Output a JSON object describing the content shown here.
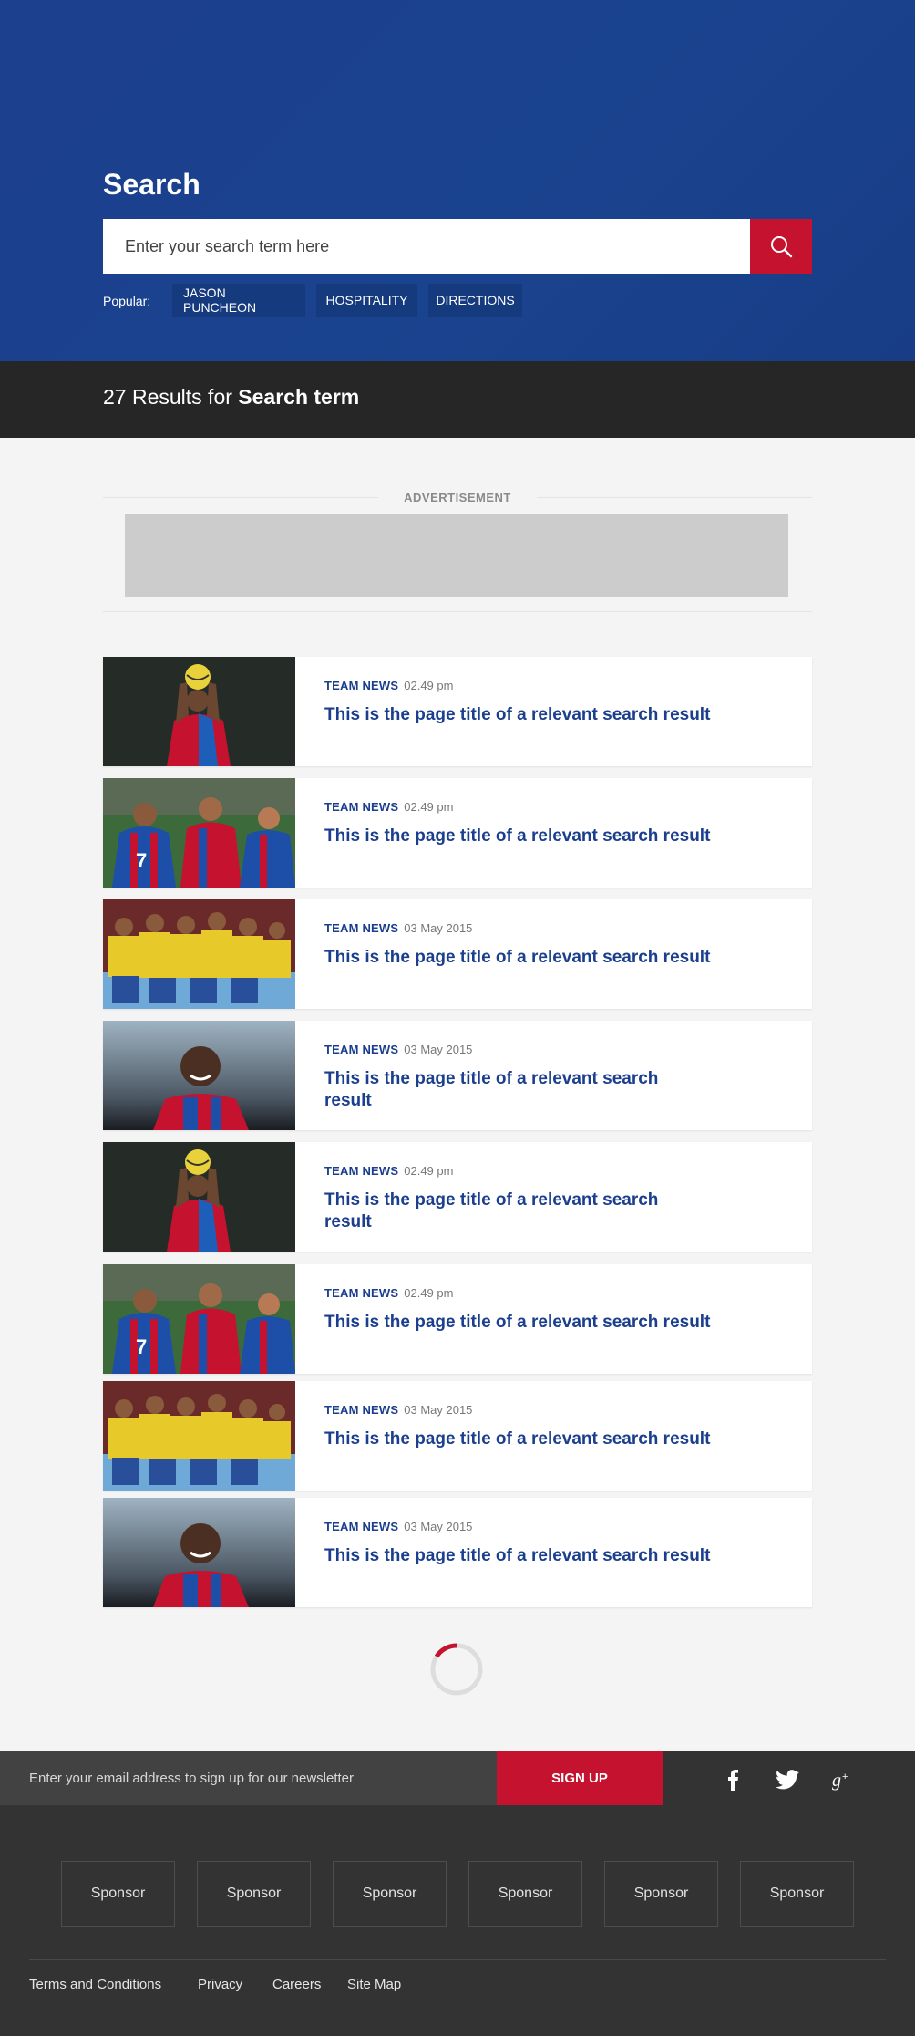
{
  "hero": {
    "title": "Search",
    "search_placeholder": "Enter your search term here",
    "popular_label": "Popular:",
    "popular_tags": [
      "JASON PUNCHEON",
      "HOSPITALITY",
      "DIRECTIONS"
    ]
  },
  "results": {
    "count_prefix": "27 Results for ",
    "term": "Search term"
  },
  "ad": {
    "label": "ADVERTISEMENT"
  },
  "items": [
    {
      "category": "TEAM NEWS",
      "date": "02.49 pm",
      "title": "This is the page title of a relevant search result",
      "image": "player-ball-overhead"
    },
    {
      "category": "TEAM NEWS",
      "date": "02.49 pm",
      "title": "This is the page title of a relevant search result",
      "image": "players-celebrating"
    },
    {
      "category": "TEAM NEWS",
      "date": "03 May 2015",
      "title": "This is the page title of a relevant search result",
      "image": "team-huddle-yellow"
    },
    {
      "category": "TEAM NEWS",
      "date": "03 May 2015",
      "title": "This is the page title of a relevant search result",
      "image": "player-smiling"
    },
    {
      "category": "TEAM NEWS",
      "date": "02.49 pm",
      "title": "This is the page title of a relevant search result",
      "image": "player-ball-overhead"
    },
    {
      "category": "TEAM NEWS",
      "date": "02.49 pm",
      "title": "This is the page title of a relevant search result",
      "image": "players-celebrating"
    },
    {
      "category": "TEAM NEWS",
      "date": "03 May 2015",
      "title": "This is the page title of a relevant search result",
      "image": "team-huddle-yellow"
    },
    {
      "category": "TEAM NEWS",
      "date": "03 May 2015",
      "title": "This is the page title of a relevant search result",
      "image": "player-smiling"
    }
  ],
  "footer": {
    "newsletter_placeholder": "Enter your email address to sign up for our newsletter",
    "signup_label": "SIGN UP",
    "social": [
      "facebook-icon",
      "twitter-icon",
      "google-plus-icon"
    ],
    "sponsors": [
      "Sponsor",
      "Sponsor",
      "Sponsor",
      "Sponsor",
      "Sponsor",
      "Sponsor"
    ],
    "links": [
      "Terms and Conditions",
      "Privacy",
      "Careers",
      "Site Map"
    ]
  },
  "colors": {
    "primary_blue": "#1b3f8e",
    "accent_red": "#c4122f",
    "dark_bar": "#262626",
    "footer_bg": "#333333"
  }
}
